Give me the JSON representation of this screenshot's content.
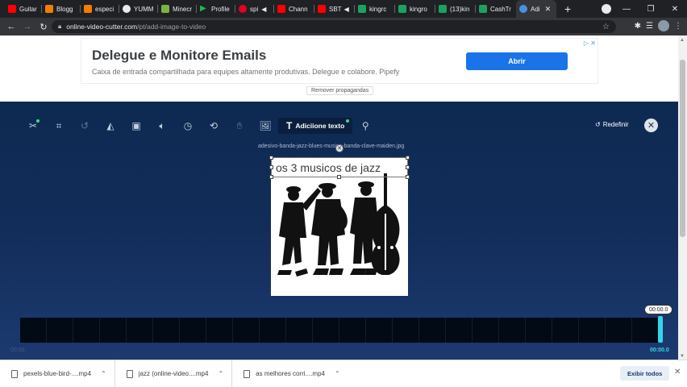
{
  "browser": {
    "tabs": [
      {
        "label": "Guitar",
        "color": "#ff0000"
      },
      {
        "label": "Blogg",
        "color": "#f57d00"
      },
      {
        "label": "especi",
        "color": "#f57d00"
      },
      {
        "label": "YUMM",
        "color": "#e8eaed"
      },
      {
        "label": "Minecr",
        "color": "#7cb342"
      },
      {
        "label": "Profile",
        "color": "#1db954"
      },
      {
        "label": "spi",
        "color": "#e60023"
      },
      {
        "label": "Chann",
        "color": "#ff0000"
      },
      {
        "label": "SBT",
        "color": "#ff0000"
      },
      {
        "label": "kingrc",
        "color": "#1aa260"
      },
      {
        "label": "kingro",
        "color": "#1aa260"
      },
      {
        "label": "(13)kin",
        "color": "#1aa260"
      },
      {
        "label": "CashTr",
        "color": "#1aa260"
      },
      {
        "label": "Adi",
        "color": "#4a90e2",
        "active": true
      }
    ],
    "new_tab_symbol": "+",
    "url_domain": "online-video-cutter.com",
    "url_path": "/pt/add-image-to-video"
  },
  "ad": {
    "title": "Delegue e Monitore Emails",
    "description": "Caixa de entrada compartilhada para equipes altamente produtivas. Delegue e colabore. Pipefy",
    "button": "Abrir",
    "remove_ads": "Remover propagandas"
  },
  "editor": {
    "toolbar": {
      "icons": [
        "scissors-icon",
        "crop-icon",
        "rotate-icon",
        "flip-icon",
        "resize-icon",
        "volume-icon",
        "speed-icon",
        "loop-icon",
        "stabilize-icon",
        "add-image-icon"
      ],
      "active_label": "Adiciione texto",
      "accent": "#3ddc84"
    },
    "reset_label": "Redefinir",
    "filename": "adesivo-banda-jazz-blues-musica-banda-clave-maiden.jpg",
    "overlay_text": "os 3 musicos de jazz",
    "timeline": {
      "current_time_bubble": "00:00.0",
      "start_time": "00:00.",
      "end_time": "00:00.0"
    }
  },
  "downloads": {
    "items": [
      {
        "name": "pexels-blue-bird-....mp4"
      },
      {
        "name": "jazz (online-video....mp4"
      },
      {
        "name": "as melhores corri....mp4"
      }
    ],
    "show_all": "Exibir todos"
  }
}
